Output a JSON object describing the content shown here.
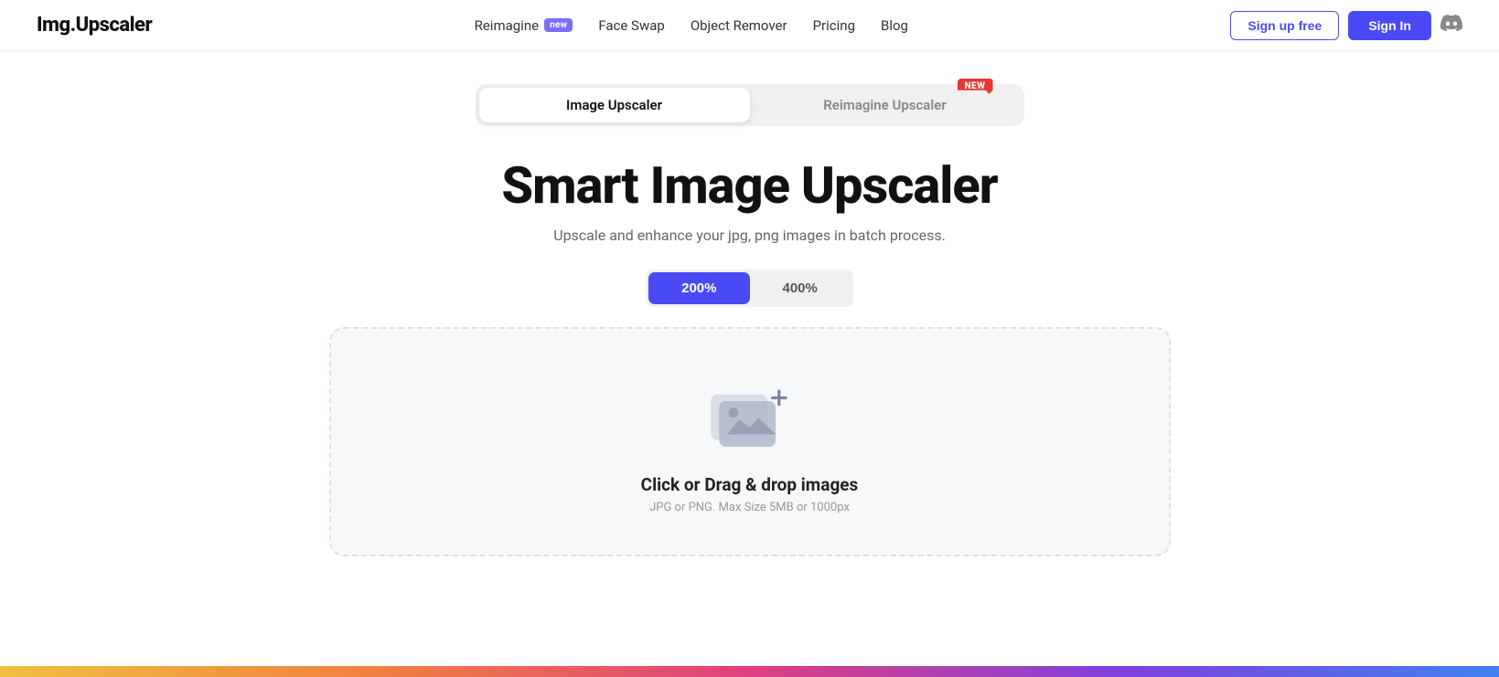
{
  "logo": "Img.Upscaler",
  "nav": {
    "links": [
      {
        "id": "reimagine",
        "label": "Reimagine",
        "badge": "new",
        "hasBadge": true
      },
      {
        "id": "faceswap",
        "label": "Face Swap",
        "hasBadge": false
      },
      {
        "id": "objectremover",
        "label": "Object Remover",
        "hasBadge": false
      },
      {
        "id": "pricing",
        "label": "Pricing",
        "hasBadge": false
      },
      {
        "id": "blog",
        "label": "Blog",
        "hasBadge": false
      }
    ],
    "signup_label": "Sign up free",
    "signin_label": "Sign In"
  },
  "tabs": [
    {
      "id": "image-upscaler",
      "label": "Image Upscaler",
      "active": true,
      "newBadge": false
    },
    {
      "id": "reimagine-upscaler",
      "label": "Reimagine Upscaler",
      "active": false,
      "newBadge": true
    }
  ],
  "hero": {
    "title": "Smart Image Upscaler",
    "subtitle": "Upscale and enhance your jpg, png images in batch process."
  },
  "scale_options": [
    {
      "id": "200",
      "label": "200%",
      "active": true
    },
    {
      "id": "400",
      "label": "400%",
      "active": false
    }
  ],
  "dropzone": {
    "title": "Click or Drag & drop images",
    "subtitle": "JPG or PNG. Max Size 5MB or 1000px"
  },
  "new_badge_label": "NEW",
  "colors": {
    "accent": "#4a4af4",
    "badge_new": "#7c6ff7",
    "badge_new_tab": "#e53935"
  }
}
